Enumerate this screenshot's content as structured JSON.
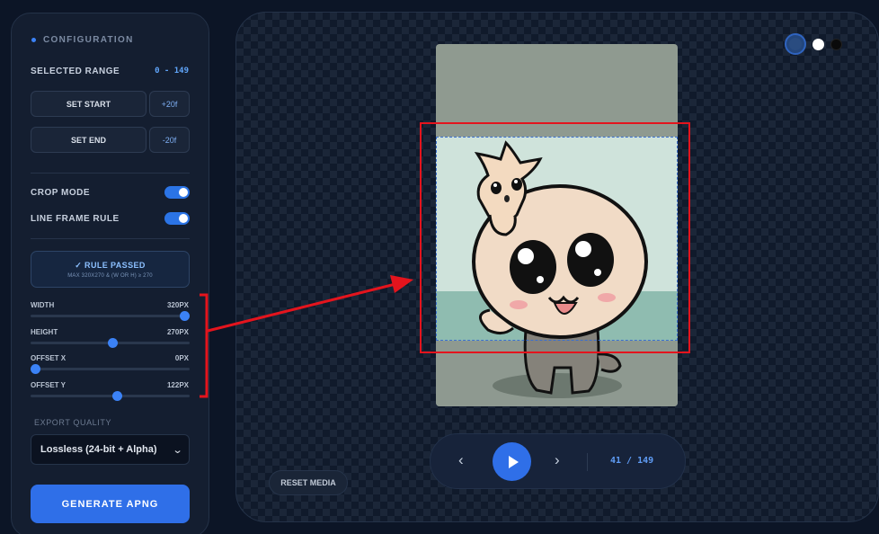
{
  "sidebar": {
    "section_title": "CONFIGURATION",
    "selected_range_label": "SELECTED RANGE",
    "selected_range_value": "0 - 149",
    "set_start_label": "SET START",
    "set_start_step": "+20f",
    "set_end_label": "SET END",
    "set_end_step": "-20f",
    "crop_mode_label": "CROP MODE",
    "crop_mode_on": true,
    "line_frame_rule_label": "LINE FRAME RULE",
    "line_frame_rule_on": true,
    "rule_title": "✓ RULE PASSED",
    "rule_subtitle": "MAX 320X270 & (W OR H) ≥ 270",
    "sliders": [
      {
        "label": "WIDTH",
        "value_text": "320PX",
        "level": 1.0
      },
      {
        "label": "HEIGHT",
        "value_text": "270PX",
        "level": 0.52
      },
      {
        "label": "OFFSET X",
        "value_text": "0PX",
        "level": 0.0
      },
      {
        "label": "OFFSET Y",
        "value_text": "122PX",
        "level": 0.55
      }
    ],
    "export_quality_label": "EXPORT QUALITY",
    "export_quality_value": "Lossless (24-bit + Alpha)",
    "generate_label": "GENERATE APNG"
  },
  "stage": {
    "background_swatches": [
      "#23467d",
      "#ffffff",
      "#0a0a0a"
    ],
    "selected_swatch": 0,
    "reset_label": "RESET MEDIA",
    "frame_counter": "41 / 149",
    "prev_icon": "chevron-left",
    "play_icon": "play",
    "next_icon": "chevron-right"
  },
  "colors": {
    "accent": "#2f6fe8",
    "annotation": "#e4141d"
  }
}
